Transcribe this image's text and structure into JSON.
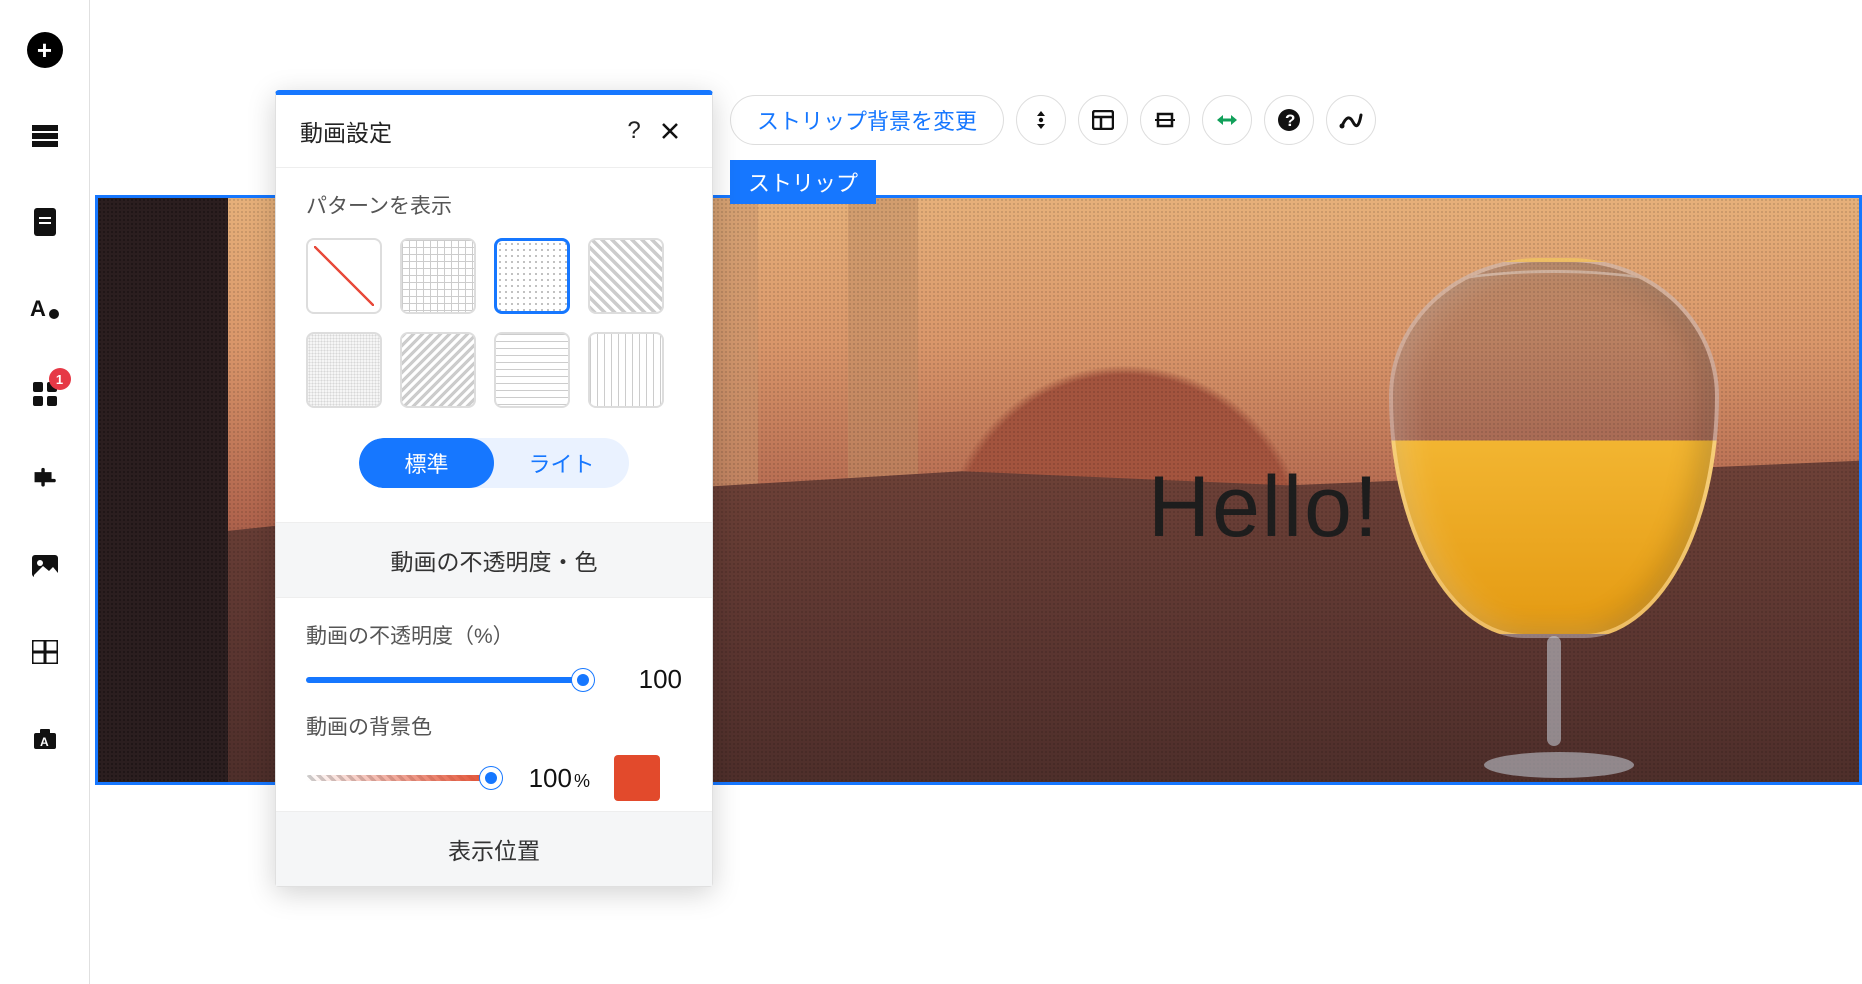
{
  "left_toolbar": {
    "badge": "1"
  },
  "canvas": {
    "hello": "Hello!"
  },
  "action_bar": {
    "change_bg": "ストリップ背景を変更"
  },
  "strip_label": "ストリップ",
  "panel": {
    "title": "動画設定",
    "pattern_label": "パターンを表示",
    "seg_standard": "標準",
    "seg_light": "ライト",
    "opacity_section": "動画の不透明度・色",
    "opacity_label": "動画の不透明度（%）",
    "opacity_value": "100",
    "bgcolor_label": "動画の背景色",
    "bgcolor_value": "100",
    "bgcolor_pct": "%",
    "bgcolor_hex": "#e24a2c",
    "position_section": "表示位置"
  }
}
